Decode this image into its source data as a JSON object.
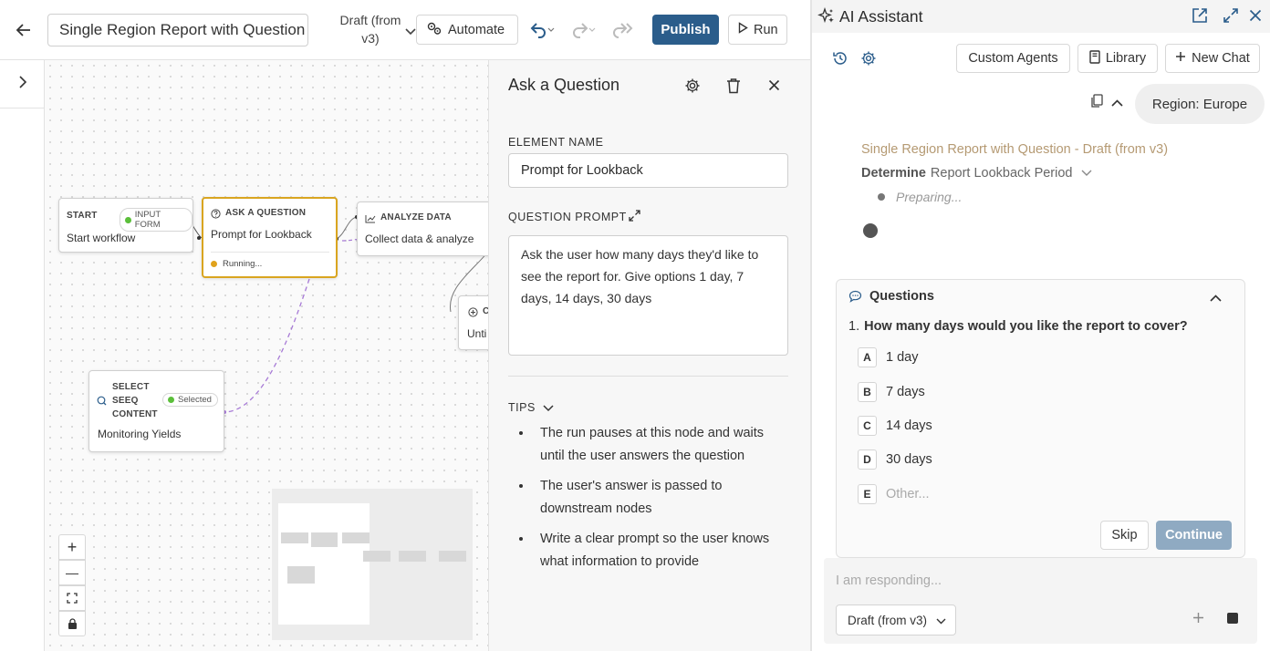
{
  "topbar": {
    "title": "Single Region Report with Question",
    "draft_line1": "Draft (from",
    "draft_line2": "v3)",
    "automate_label": "Automate",
    "publish_label": "Publish",
    "run_label": "Run"
  },
  "canvas": {
    "nodes": {
      "start": {
        "type": "START",
        "badge": "INPUT FORM",
        "name": "Start workflow"
      },
      "ask": {
        "type": "ASK A QUESTION",
        "name": "Prompt for Lookback",
        "status": "Running..."
      },
      "analyze": {
        "type": "ANALYZE DATA",
        "name": "Collect data & analyze"
      },
      "loop": {
        "type": "C",
        "name": "Unti"
      },
      "select": {
        "type_line1": "SELECT",
        "type_line2": "SEEQ",
        "type_line3": "CONTENT",
        "badge": "Selected",
        "name": "Monitoring Yields"
      }
    },
    "zoom": {
      "in": "+",
      "out": "—"
    }
  },
  "properties": {
    "title": "Ask a Question",
    "element_name_label": "ELEMENT NAME",
    "element_name_value": "Prompt for Lookback",
    "question_prompt_label": "QUESTION PROMPT",
    "question_prompt_value": "Ask the user how many days they'd like to see the report for. Give options 1 day, 7 days, 14 days, 30 days",
    "tips_label": "TIPS",
    "tips": [
      "The run pauses at this node and waits until the user answers the question",
      "The user's answer is passed to downstream nodes",
      "Write a clear prompt so the user knows what information to provide"
    ]
  },
  "assistant": {
    "title": "AI Assistant",
    "custom_agents_label": "Custom Agents",
    "library_label": "Library",
    "new_chat_label": "New Chat",
    "region_chip": "Region: Europe",
    "workflow_ref": "Single Region Report with Question - Draft (from v3)",
    "step_bold": "Determine",
    "step_rest": "Report Lookback Period",
    "preparing": "Preparing...",
    "questions_title": "Questions",
    "question_number": "1.",
    "question_text": "How many days would you like the report to cover?",
    "options": [
      {
        "letter": "A",
        "label": "1 day"
      },
      {
        "letter": "B",
        "label": "7 days"
      },
      {
        "letter": "C",
        "label": "14 days"
      },
      {
        "letter": "D",
        "label": "30 days"
      },
      {
        "letter": "E",
        "label": "Other..."
      }
    ],
    "skip_label": "Skip",
    "continue_label": "Continue",
    "reply_placeholder": "I am responding...",
    "model_select": "Draft (from v3)"
  },
  "colors": {
    "publish": "#2b5d8b",
    "ask_node_border": "#d9a520",
    "workflow_ref": "#b59a73",
    "running_dot": "#e0a21c",
    "selected_dot": "#5bbf3a",
    "continue_disabled": "#8faac2"
  }
}
